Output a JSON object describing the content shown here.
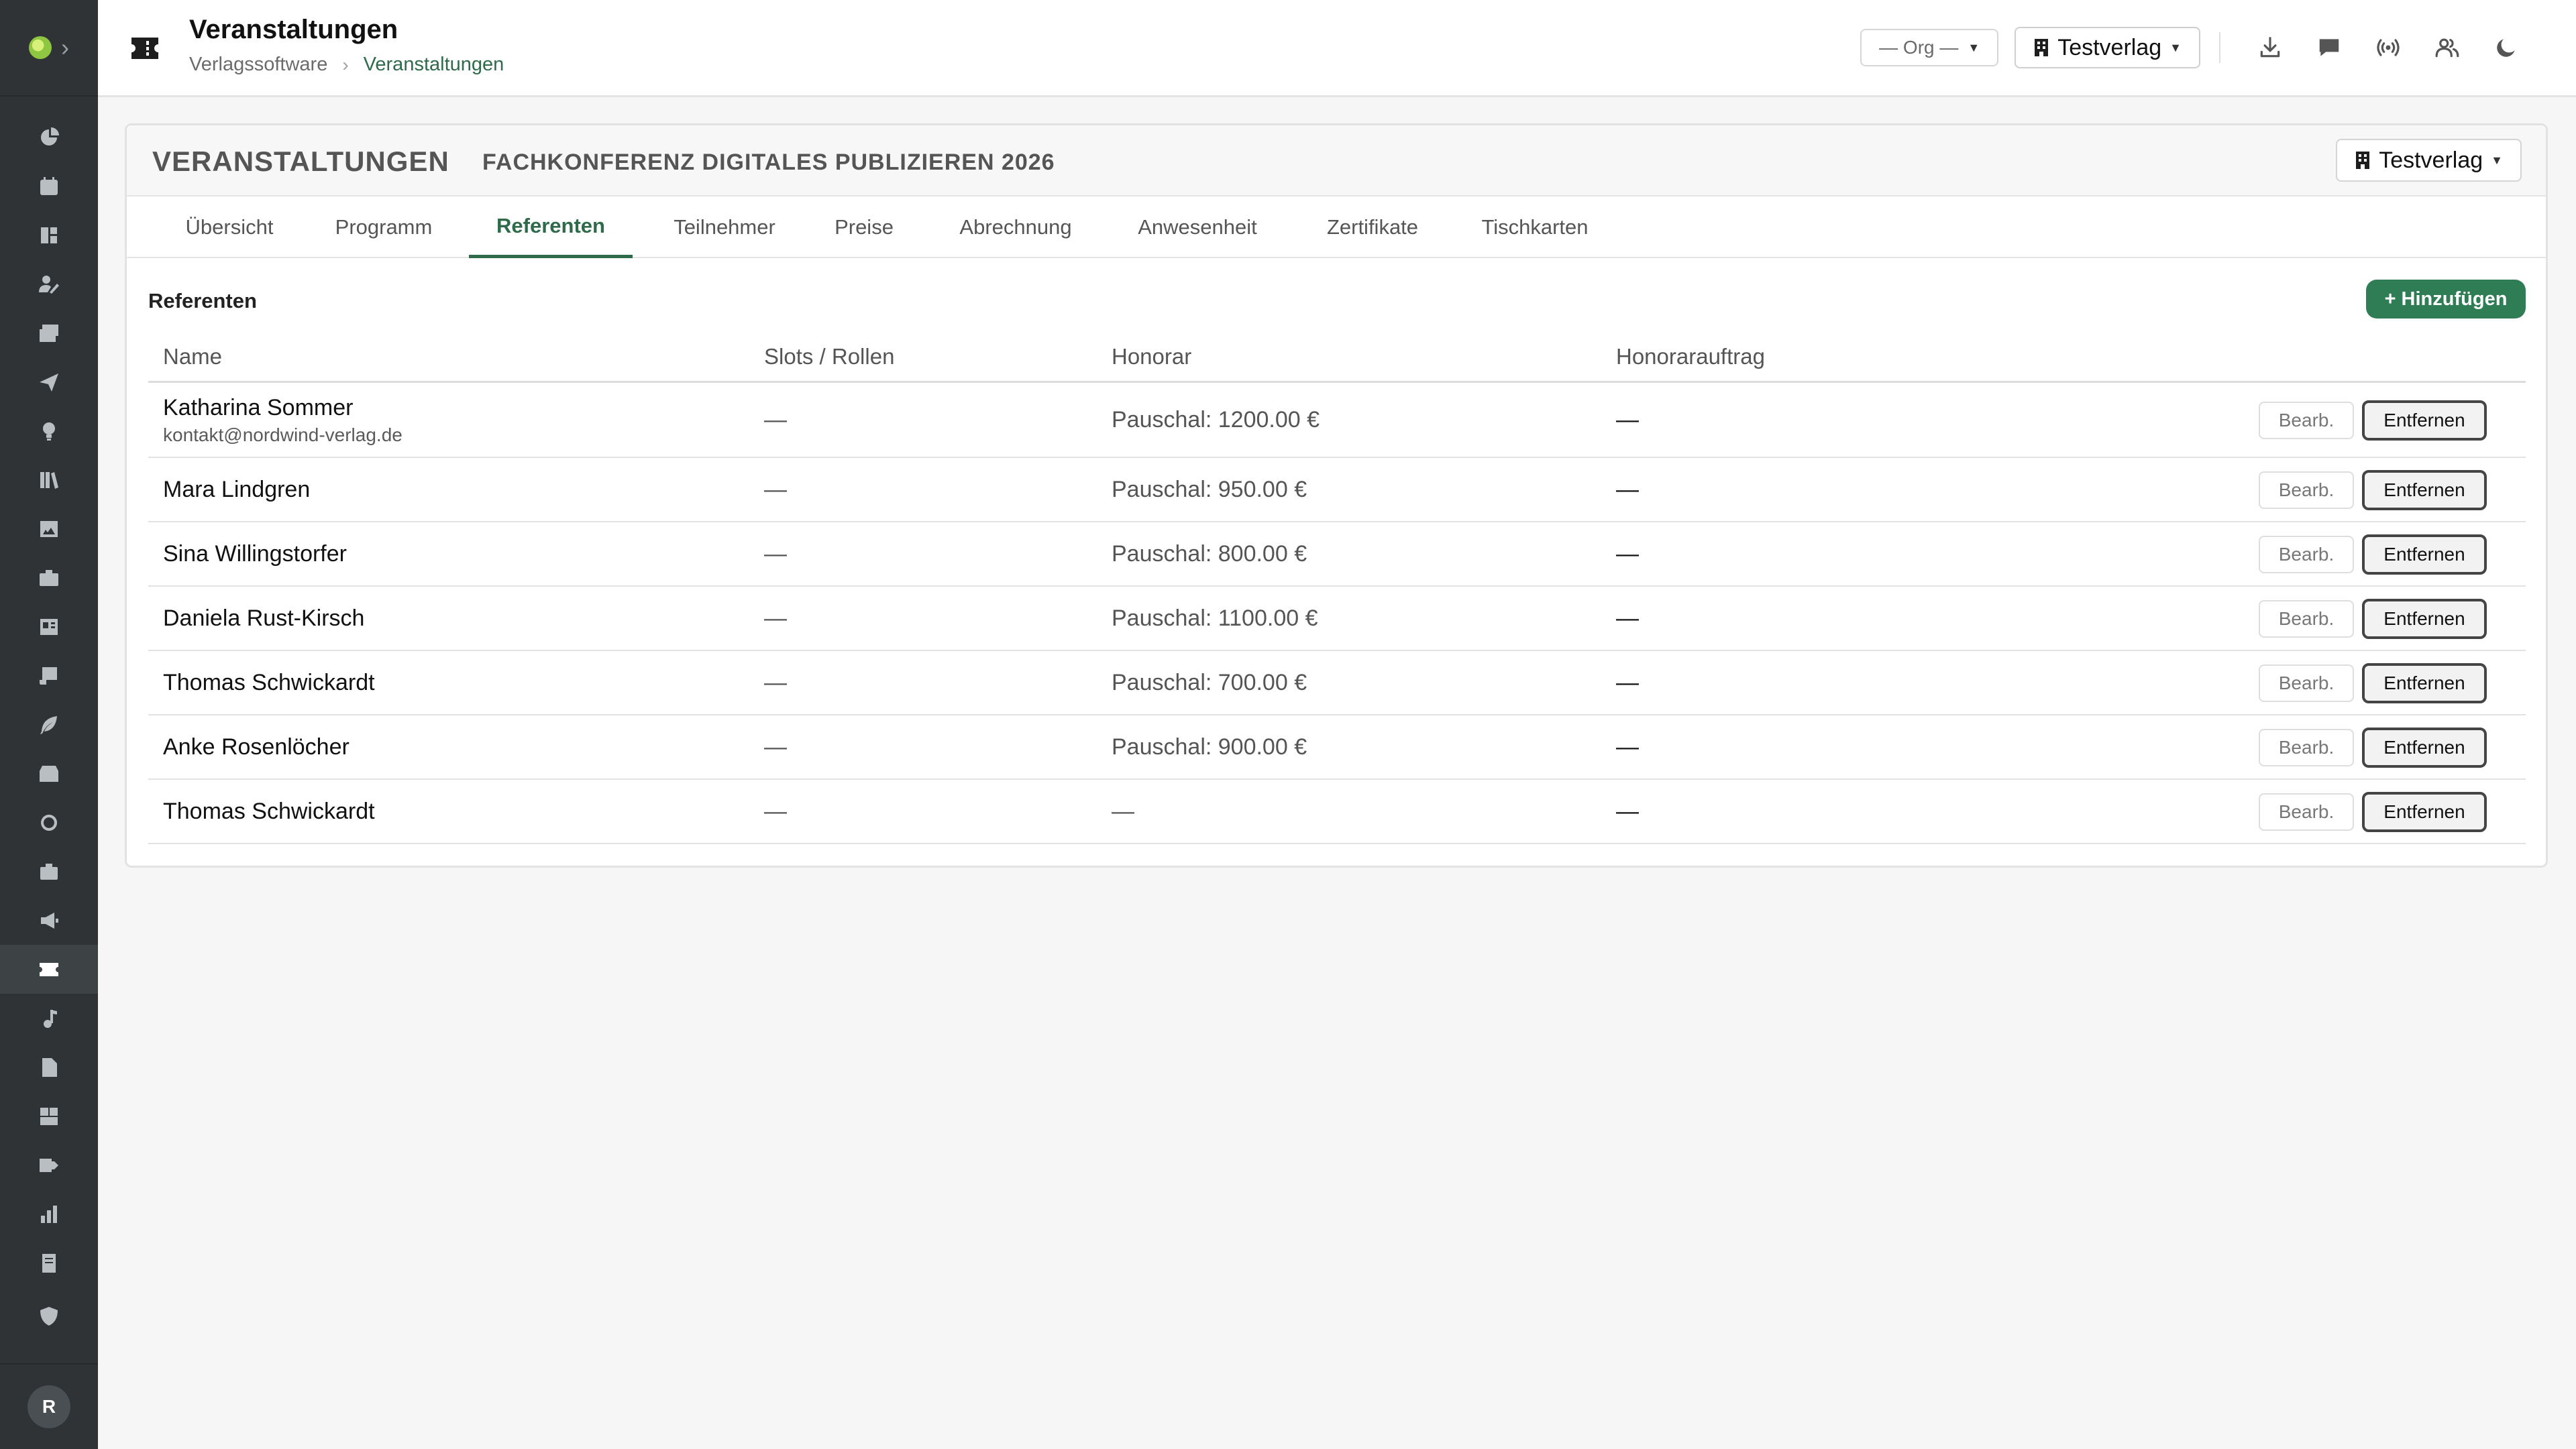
{
  "header": {
    "title": "Veranstaltungen",
    "breadcrumb": [
      "Verlagssoftware",
      "Veranstaltungen"
    ],
    "org_select": "— Org —",
    "publisher_select": "Testverlag"
  },
  "sidebar": {
    "avatar_initial": "R",
    "active_index": 17,
    "icons": [
      "dashboard-icon",
      "calendar-icon",
      "board-icon",
      "user-edit-icon",
      "mail-stack-icon",
      "send-icon",
      "lightbulb-icon",
      "library-icon",
      "image-icon",
      "briefcase-icon",
      "news-card-icon",
      "scroll-icon",
      "feather-icon",
      "archive-icon",
      "circle-icon",
      "case-icon",
      "megaphone-icon",
      "ticket-icon",
      "music-icon",
      "document-icon",
      "warehouse-icon",
      "shipping-icon",
      "bar-chart-icon",
      "book-icon",
      "shield-icon"
    ]
  },
  "card": {
    "title": "VERANSTALTUNGEN",
    "subtitle": "FACHKONFERENZ DIGITALES PUBLIZIEREN 2026",
    "publisher_select": "Testverlag"
  },
  "tabs": [
    "Übersicht",
    "Programm",
    "Referenten",
    "Teilnehmer",
    "Preise",
    "Abrechnung",
    "Anwesenheit",
    "Zertifikate",
    "Tischkarten"
  ],
  "active_tab": "Referenten",
  "section": {
    "title": "Referenten",
    "add_label": "+ Hinzufügen"
  },
  "table": {
    "columns": [
      "Name",
      "Slots / Rollen",
      "Honorar",
      "Honorarauftrag"
    ],
    "edit_label": "Bearb.",
    "remove_label": "Entfernen",
    "rows": [
      {
        "name": "Katharina Sommer",
        "email": "kontakt@nordwind-verlag.de",
        "slots": "—",
        "fee": "Pauschal: 1200.00 €",
        "order": "—"
      },
      {
        "name": "Mara Lindgren",
        "email": "",
        "slots": "—",
        "fee": "Pauschal: 950.00 €",
        "order": "—"
      },
      {
        "name": "Sina Willingstorfer",
        "email": "",
        "slots": "—",
        "fee": "Pauschal: 800.00 €",
        "order": "—"
      },
      {
        "name": "Daniela Rust-Kirsch",
        "email": "",
        "slots": "—",
        "fee": "Pauschal: 1100.00 €",
        "order": "—"
      },
      {
        "name": "Thomas Schwickardt",
        "email": "",
        "slots": "—",
        "fee": "Pauschal: 700.00 €",
        "order": "—"
      },
      {
        "name": "Anke Rosenlöcher",
        "email": "",
        "slots": "—",
        "fee": "Pauschal: 900.00 €",
        "order": "—"
      },
      {
        "name": "Thomas Schwickardt",
        "email": "",
        "slots": "—",
        "fee": "—",
        "order": "—"
      }
    ]
  },
  "colors": {
    "accent": "#2f6b4a",
    "add_button": "#2e7d55",
    "sidebar": "#2f3336"
  }
}
